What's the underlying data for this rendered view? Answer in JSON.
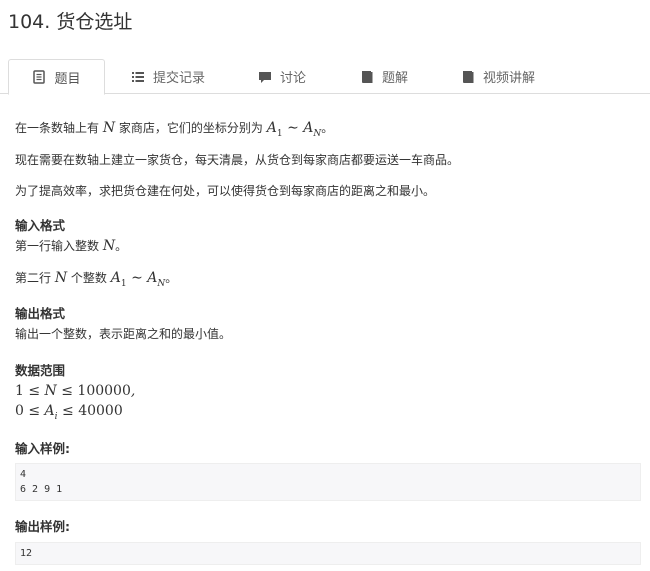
{
  "page": {
    "title": "104. 货仓选址"
  },
  "tabs": [
    {
      "label": "题目",
      "icon": "book-icon",
      "active": true
    },
    {
      "label": "提交记录",
      "icon": "list-icon",
      "active": false
    },
    {
      "label": "讨论",
      "icon": "comment-icon",
      "active": false
    },
    {
      "label": "题解",
      "icon": "book-icon",
      "active": false
    },
    {
      "label": "视频讲解",
      "icon": "book-icon",
      "active": false
    }
  ],
  "problem": {
    "p1_prefix": "在一条数轴上有",
    "p1_var": "N",
    "p1_mid": "家商店，它们的坐标分别为",
    "p1_math_a1": "A",
    "p1_math_sub1": "1",
    "p1_math_tilde": "∼",
    "p1_math_an": "A",
    "p1_math_subn": "N",
    "p1_suffix": "。",
    "p2": "现在需要在数轴上建立一家货仓，每天清晨，从货仓到每家商店都要运送一车商品。",
    "p3": "为了提高效率，求把货仓建在何处，可以使得货仓到每家商店的距离之和最小。",
    "input_title": "输入格式",
    "input_l1_prefix": "第一行输入整数",
    "input_l1_var": "N",
    "input_l1_suffix": "。",
    "input_l2_prefix": "第二行",
    "input_l2_var": "N",
    "input_l2_mid": "个整数",
    "input_l2_a1": "A",
    "input_l2_sub1": "1",
    "input_l2_tilde": "∼",
    "input_l2_an": "A",
    "input_l2_subn": "N",
    "input_l2_suffix": "。",
    "output_title": "输出格式",
    "output_text": "输出一个整数，表示距离之和的最小值。",
    "range_title": "数据范围",
    "range_l1_left": "1 ≤",
    "range_l1_var": "N",
    "range_l1_right": "≤ 100000",
    "range_l1_comma": ",",
    "range_l2_left": "0 ≤",
    "range_l2_var": "A",
    "range_l2_sub": "i",
    "range_l2_right": "≤ 40000",
    "sample_in_title": "输入样例:",
    "sample_in": "4\n6 2 9 1",
    "sample_out_title": "输出样例:",
    "sample_out": "12"
  }
}
